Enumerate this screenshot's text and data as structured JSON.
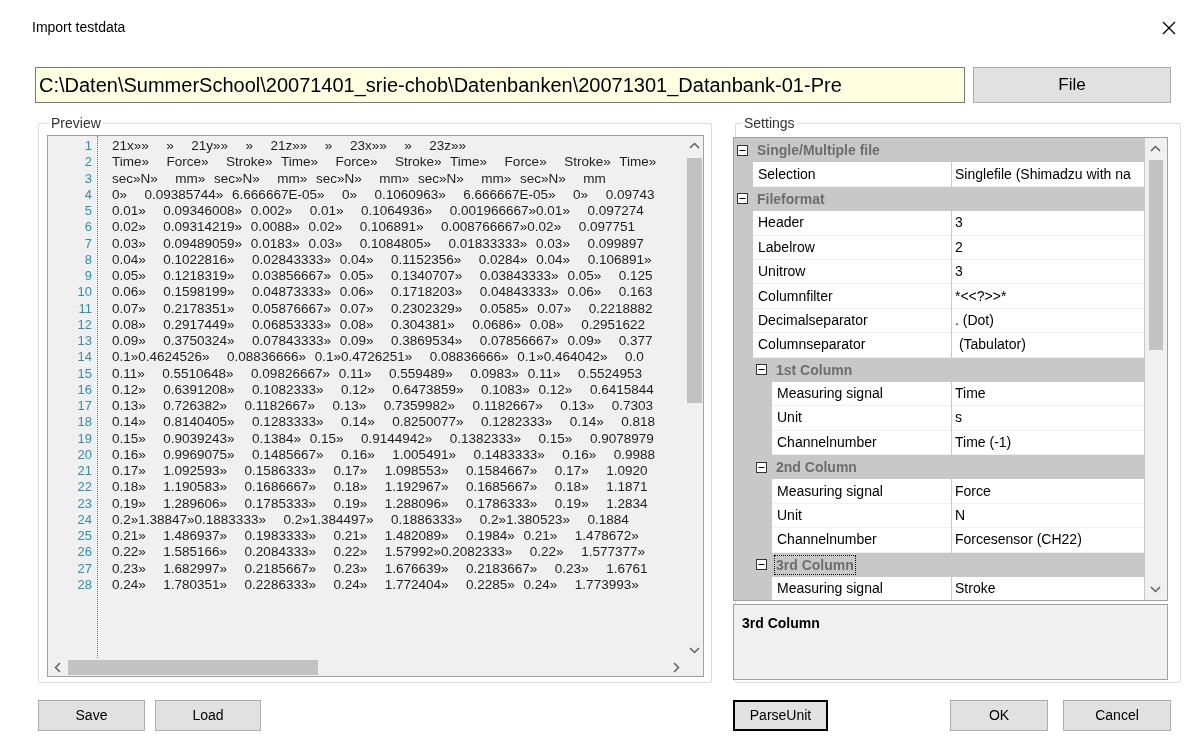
{
  "window": {
    "title": "Import testdata"
  },
  "path_field": {
    "value": "C:\\Daten\\SummerSchool\\20071401_srie-chob\\Datenbanken\\20071301_Datanbank-01-Pre"
  },
  "file_button": "File",
  "preview": {
    "label": "Preview",
    "lines": [
      {
        "number": "1",
        "text": "21x»»  »  21y»»  »  21z»»  »  23x»»  »  23z»»"
      },
      {
        "number": "2",
        "text": "Time»  Force»  Stroke» Time»  Force»  Stroke» Time»  Force»  Stroke» Time»"
      },
      {
        "number": "3",
        "text": "sec»N»  mm» sec»N»  mm» sec»N»  mm» sec»N»  mm» sec»N»  mm"
      },
      {
        "number": "4",
        "text": "0»  0.09385744» 6.666667E-05»  0»  0.1060963»  6.666667E-05»  0»  0.09743"
      },
      {
        "number": "5",
        "text": "0.01»  0.09346008» 0.002»  0.01»  0.1064936»  0.001966667»0.01»  0.097274"
      },
      {
        "number": "6",
        "text": "0.02»  0.09314219» 0.0088» 0.02»  0.106891»  0.008766667»0.02»  0.097751"
      },
      {
        "number": "7",
        "text": "0.03»  0.09489059» 0.0183» 0.03»  0.1084805»  0.01833333» 0.03»  0.099897"
      },
      {
        "number": "8",
        "text": "0.04»  0.1022816»  0.02843333» 0.04»  0.1152356»  0.0284» 0.04»  0.106891»"
      },
      {
        "number": "9",
        "text": "0.05»  0.1218319»  0.03856667» 0.05»  0.1340707»  0.03843333» 0.05»  0.125"
      },
      {
        "number": "10",
        "text": "0.06»  0.1598199»  0.04873333» 0.06»  0.1718203»  0.04843333» 0.06»  0.163"
      },
      {
        "number": "11",
        "text": "0.07»  0.2178351»  0.05876667» 0.07»  0.2302329»  0.0585» 0.07»  0.2218882"
      },
      {
        "number": "12",
        "text": "0.08»  0.2917449»  0.06853333» 0.08»  0.304381»  0.0686» 0.08»  0.2951622"
      },
      {
        "number": "13",
        "text": "0.09»  0.3750324»  0.07843333» 0.09»  0.3869534»  0.07856667» 0.09»  0.377"
      },
      {
        "number": "14",
        "text": "0.1»0.4624526»  0.08836666» 0.1»0.4726251»  0.08836666» 0.1»0.464042»  0.0"
      },
      {
        "number": "15",
        "text": "0.11»  0.5510648»  0.09826667» 0.11»  0.559489»  0.0983» 0.11»  0.5524953"
      },
      {
        "number": "16",
        "text": "0.12»  0.6391208»  0.1082333»  0.12»  0.6473859»  0.1083» 0.12»  0.6415844"
      },
      {
        "number": "17",
        "text": "0.13»  0.726382»  0.1182667»  0.13»  0.7359982»  0.1182667»  0.13»  0.7303"
      },
      {
        "number": "18",
        "text": "0.14»  0.8140405»  0.1283333»  0.14»  0.8250077»  0.1282333»  0.14»  0.818"
      },
      {
        "number": "19",
        "text": "0.15»  0.9039243»  0.1384» 0.15»  0.9144942»  0.1382333»  0.15»  0.9078979"
      },
      {
        "number": "20",
        "text": "0.16»  0.9969075»  0.1485667»  0.16»  1.005491»  0.1483333»  0.16»  0.9988"
      },
      {
        "number": "21",
        "text": "0.17»  1.092593»  0.1586333»  0.17»  1.098553»  0.1584667»  0.17»  1.0920"
      },
      {
        "number": "22",
        "text": "0.18»  1.190583»  0.1686667»  0.18»  1.192967»  0.1685667»  0.18»  1.1871"
      },
      {
        "number": "23",
        "text": "0.19»  1.289606»  0.1785333»  0.19»  1.288096»  0.1786333»  0.19»  1.2834"
      },
      {
        "number": "24",
        "text": "0.2»1.38847»0.1883333»  0.2»1.384497»  0.1886333»  0.2»1.380523»  0.1884"
      },
      {
        "number": "25",
        "text": "0.21»  1.486937»  0.1983333»  0.21»  1.482089»  0.1984» 0.21»  1.478672»"
      },
      {
        "number": "26",
        "text": "0.22»  1.585166»  0.2084333»  0.22»  1.57992»0.2082333»  0.22»  1.577377»"
      },
      {
        "number": "27",
        "text": "0.23»  1.682997»  0.2185667»  0.23»  1.676639»  0.2183667»  0.23»  1.6761"
      },
      {
        "number": "28",
        "text": "0.24»  1.780351»  0.2286333»  0.24»  1.772404»  0.2285» 0.24»  1.773993»"
      }
    ]
  },
  "settings": {
    "label": "Settings",
    "categories": [
      {
        "label": "Single/Multiple file",
        "expanded": true,
        "selected": false,
        "properties": [
          {
            "name": "Selection",
            "value": "Singlefile (Shimadzu with na"
          }
        ]
      },
      {
        "label": "Fileformat",
        "expanded": true,
        "selected": false,
        "properties": [
          {
            "name": "Header",
            "value": "3"
          },
          {
            "name": "Labelrow",
            "value": "2"
          },
          {
            "name": "Unitrow",
            "value": "3"
          },
          {
            "name": "Columnfilter",
            "value": "*<<?>>*"
          },
          {
            "name": "Decimalseparator",
            "value": ". (Dot)"
          },
          {
            "name": "Columnseparator",
            "value": " (Tabulator)"
          }
        ],
        "children": [
          {
            "label": "1st Column",
            "expanded": true,
            "selected": false,
            "properties": [
              {
                "name": "Measuring signal",
                "value": "Time"
              },
              {
                "name": "Unit",
                "value": "s"
              },
              {
                "name": "Channelnumber",
                "value": "Time (-1)"
              }
            ]
          },
          {
            "label": "2nd Column",
            "expanded": true,
            "selected": false,
            "properties": [
              {
                "name": "Measuring signal",
                "value": "Force"
              },
              {
                "name": "Unit",
                "value": "N"
              },
              {
                "name": "Channelnumber",
                "value": "Forcesensor (CH22)"
              }
            ]
          },
          {
            "label": "3rd Column",
            "expanded": true,
            "selected": true,
            "properties": [
              {
                "name": "Measuring signal",
                "value": "Stroke"
              }
            ]
          }
        ]
      }
    ],
    "description": "3rd Column"
  },
  "buttons": [
    {
      "label": "Save",
      "default": false
    },
    {
      "label": "Load",
      "default": false
    },
    {
      "label": "ParseUnit",
      "default": true
    },
    {
      "label": "OK",
      "default": false
    },
    {
      "label": "Cancel",
      "default": false
    }
  ]
}
